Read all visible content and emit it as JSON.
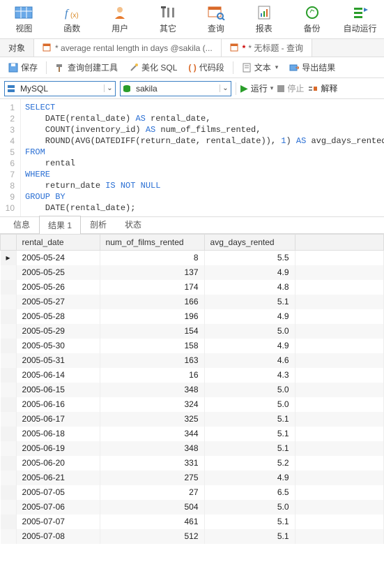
{
  "toolbar": {
    "items": [
      {
        "label": "视图"
      },
      {
        "label": "函数"
      },
      {
        "label": "用户"
      },
      {
        "label": "其它"
      },
      {
        "label": "查询"
      },
      {
        "label": "报表"
      },
      {
        "label": "备份"
      },
      {
        "label": "自动运行"
      }
    ]
  },
  "tabs": {
    "object": "对象",
    "doc1": "* average rental length in days @sakila (...",
    "doc2": "* 无标题 - 查询"
  },
  "actions": {
    "save": "保存",
    "queryBuilder": "查询创建工具",
    "beautify": "美化 SQL",
    "codeSnippet": "代码段",
    "text": "文本",
    "export": "导出结果"
  },
  "conn": {
    "server": "MySQL",
    "db": "sakila",
    "run": "运行",
    "stop": "停止",
    "explain": "解释"
  },
  "sql": {
    "lines": [
      "1",
      "2",
      "3",
      "4",
      "5",
      "6",
      "7",
      "8",
      "9",
      "10"
    ]
  },
  "subtabs": {
    "info": "信息",
    "result": "结果 1",
    "profile": "剖析",
    "status": "状态"
  },
  "grid": {
    "headers": {
      "c1": "rental_date",
      "c2": "num_of_films_rented",
      "c3": "avg_days_rented"
    },
    "rows": [
      {
        "d": "2005-05-24",
        "n": "8",
        "a": "5.5"
      },
      {
        "d": "2005-05-25",
        "n": "137",
        "a": "4.9"
      },
      {
        "d": "2005-05-26",
        "n": "174",
        "a": "4.8"
      },
      {
        "d": "2005-05-27",
        "n": "166",
        "a": "5.1"
      },
      {
        "d": "2005-05-28",
        "n": "196",
        "a": "4.9"
      },
      {
        "d": "2005-05-29",
        "n": "154",
        "a": "5.0"
      },
      {
        "d": "2005-05-30",
        "n": "158",
        "a": "4.9"
      },
      {
        "d": "2005-05-31",
        "n": "163",
        "a": "4.6"
      },
      {
        "d": "2005-06-14",
        "n": "16",
        "a": "4.3"
      },
      {
        "d": "2005-06-15",
        "n": "348",
        "a": "5.0"
      },
      {
        "d": "2005-06-16",
        "n": "324",
        "a": "5.0"
      },
      {
        "d": "2005-06-17",
        "n": "325",
        "a": "5.1"
      },
      {
        "d": "2005-06-18",
        "n": "344",
        "a": "5.1"
      },
      {
        "d": "2005-06-19",
        "n": "348",
        "a": "5.1"
      },
      {
        "d": "2005-06-20",
        "n": "331",
        "a": "5.2"
      },
      {
        "d": "2005-06-21",
        "n": "275",
        "a": "4.9"
      },
      {
        "d": "2005-07-05",
        "n": "27",
        "a": "6.5"
      },
      {
        "d": "2005-07-06",
        "n": "504",
        "a": "5.0"
      },
      {
        "d": "2005-07-07",
        "n": "461",
        "a": "5.1"
      },
      {
        "d": "2005-07-08",
        "n": "512",
        "a": "5.1"
      }
    ]
  }
}
